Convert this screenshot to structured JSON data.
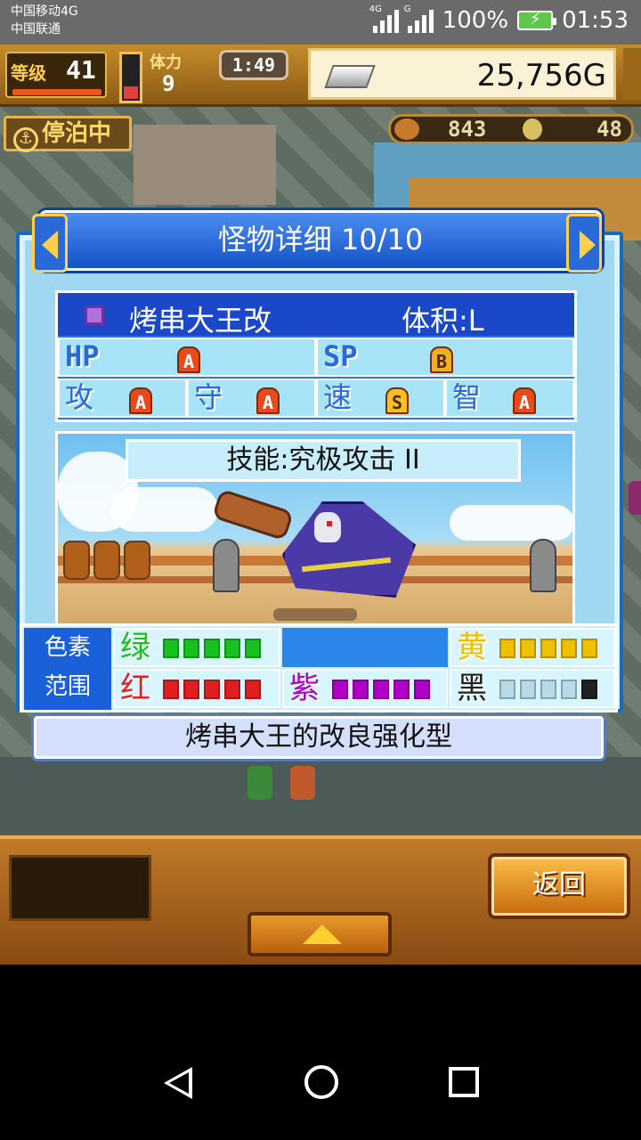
{
  "status_bar": {
    "carrier_1": "中国移动4G",
    "carrier_2": "中国联通",
    "signal_1_tag": "4G",
    "signal_2_tag": "G",
    "battery": "100%",
    "time": "01:53"
  },
  "hud": {
    "level_label": "等级",
    "level": "41",
    "stamina_label": "体力",
    "stamina": "9",
    "timer": "1:49",
    "gold": "25,756G",
    "docked_label": "停泊中",
    "resource_1": "843",
    "resource_2": "48"
  },
  "dialog": {
    "title": "怪物详细 10/10",
    "monster_name": "烤串大王改",
    "volume": "体积:L",
    "stats": [
      {
        "label": "HP",
        "grade": "A"
      },
      {
        "label": "SP",
        "grade": "B"
      },
      {
        "label": "攻",
        "grade": "A"
      },
      {
        "label": "守",
        "grade": "A"
      },
      {
        "label": "速",
        "grade": "S"
      },
      {
        "label": "智",
        "grade": "A"
      }
    ],
    "skill": "技能:究极攻击 II",
    "color_label_1": "色素",
    "color_label_2": "范围",
    "colors": [
      {
        "name": "绿",
        "color": "#18c020",
        "filled": 5
      },
      {
        "name": "黄",
        "color": "#f0c000",
        "filled": 5
      },
      {
        "name": "红",
        "color": "#e02020",
        "filled": 5
      },
      {
        "name": "紫",
        "color": "#b000c8",
        "filled": 5
      },
      {
        "name": "黑",
        "color": "#202020",
        "filled": 1
      }
    ],
    "description": "烤串大王的改良强化型"
  },
  "menu": {
    "back_label": "返回"
  }
}
